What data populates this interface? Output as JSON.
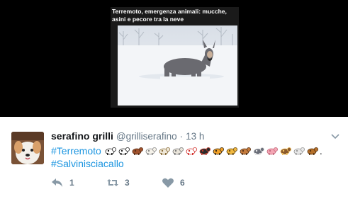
{
  "card": {
    "title": "Terremoto, emergenza animali: mucche, asini e pecore tra la neve"
  },
  "tweet": {
    "author_name": "serafino grilli",
    "handle": "@grilliserafino",
    "separator": "·",
    "time": "13 h",
    "hashtag_1": "#Terremoto",
    "hashtag_2": "#Salvinisciacallo",
    "trailing_dot": ".",
    "emojis": [
      "cow-emoji",
      "cow-emoji",
      "ox-emoji",
      "sheep-emoji",
      "ram-emoji",
      "goat-emoji",
      "rooster-emoji",
      "turkey-emoji",
      "tiger-emoji",
      "leopard-emoji",
      "dog-emoji",
      "bird-emoji",
      "pig-emoji",
      "owl-emoji",
      "rabbit-emoji",
      "chipmunk-emoji"
    ]
  },
  "actions": {
    "reply_count": "1",
    "retweet_count": "3",
    "like_count": "6"
  },
  "colors": {
    "link": "#1b95e0",
    "muted": "#657786",
    "text": "#14171a",
    "media_bg": "#000000"
  }
}
